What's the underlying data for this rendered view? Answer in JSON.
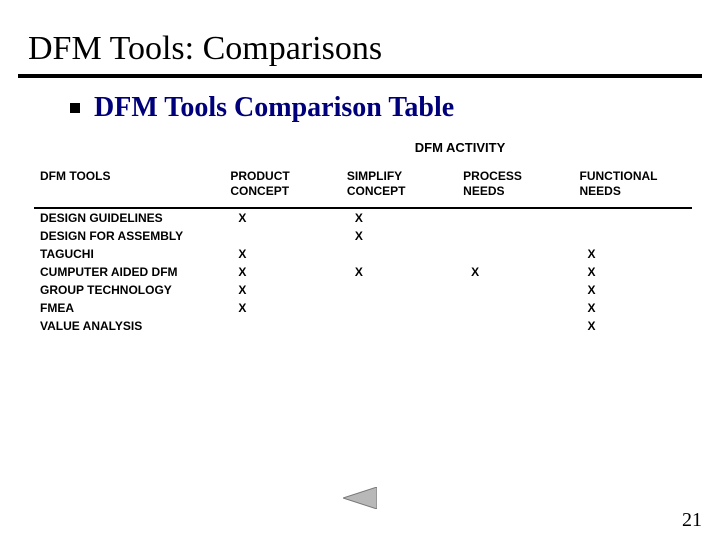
{
  "title": "DFM Tools: Comparisons",
  "subtitle": "DFM Tools Comparison Table",
  "activity_header": "DFM ACTIVITY",
  "columns": {
    "tools": "DFM TOOLS",
    "product": "PRODUCT\nCONCEPT",
    "simplify": "SIMPLIFY\nCONCEPT",
    "process": "PROCESS\nNEEDS",
    "functional": "FUNCTIONAL\nNEEDS"
  },
  "rows": [
    {
      "tool": "DESIGN GUIDELINES",
      "product": "X",
      "simplify": "X",
      "process": "",
      "functional": ""
    },
    {
      "tool": "DESIGN FOR ASSEMBLY",
      "product": "",
      "simplify": "X",
      "process": "",
      "functional": ""
    },
    {
      "tool": "TAGUCHI",
      "product": "X",
      "simplify": "",
      "process": "",
      "functional": "X"
    },
    {
      "tool": "CUMPUTER AIDED DFM",
      "product": "X",
      "simplify": "X",
      "process": "X",
      "functional": "X"
    },
    {
      "tool": "GROUP TECHNOLOGY",
      "product": "X",
      "simplify": "",
      "process": "",
      "functional": "X"
    },
    {
      "tool": "FMEA",
      "product": "X",
      "simplify": "",
      "process": "",
      "functional": "X"
    },
    {
      "tool": "VALUE ANALYSIS",
      "product": "",
      "simplify": "",
      "process": "",
      "functional": "X"
    }
  ],
  "page_number": "21",
  "nav": {
    "prev_icon": "prev"
  },
  "chart_data": {
    "type": "table",
    "title": "DFM Tools Comparison Table",
    "columns": [
      "DFM TOOLS",
      "PRODUCT CONCEPT",
      "SIMPLIFY CONCEPT",
      "PROCESS NEEDS",
      "FUNCTIONAL NEEDS"
    ],
    "rows": [
      [
        "DESIGN GUIDELINES",
        "X",
        "X",
        "",
        ""
      ],
      [
        "DESIGN FOR ASSEMBLY",
        "",
        "X",
        "",
        ""
      ],
      [
        "TAGUCHI",
        "X",
        "",
        "",
        "X"
      ],
      [
        "CUMPUTER AIDED DFM",
        "X",
        "X",
        "X",
        "X"
      ],
      [
        "GROUP TECHNOLOGY",
        "X",
        "",
        "",
        "X"
      ],
      [
        "FMEA",
        "X",
        "",
        "",
        "X"
      ],
      [
        "VALUE ANALYSIS",
        "",
        "",
        "",
        "X"
      ]
    ]
  }
}
